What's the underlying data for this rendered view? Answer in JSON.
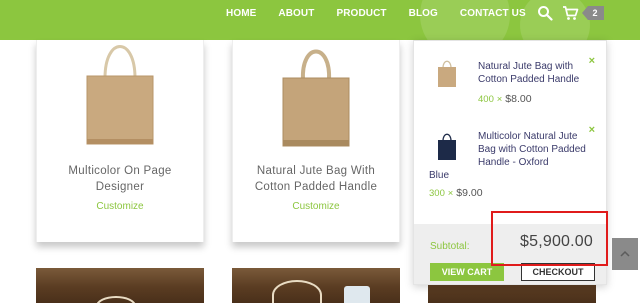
{
  "nav": {
    "items": [
      "HOME",
      "ABOUT",
      "PRODUCT",
      "BLOG",
      "CONTACT US"
    ],
    "search_icon": "search-icon",
    "cart_icon": "cart-icon",
    "cart_count": "2"
  },
  "products": [
    {
      "title": "Multicolor On Page Designer",
      "action": "Customize"
    },
    {
      "title": "Natural Jute Bag With Cotton Padded Handle",
      "action": "Customize"
    }
  ],
  "minicart": {
    "items": [
      {
        "name": "Natural Jute Bag with Cotton Padded Handle",
        "qty": "400",
        "times": "×",
        "price": "$8.00",
        "remove": "×"
      },
      {
        "name": "Multicolor Natural Jute Bag with Cotton Padded Handle - Oxford",
        "name_tail": "Blue",
        "qty": "300",
        "times": "×",
        "price": "$9.00",
        "remove": "×"
      }
    ],
    "subtotal_label": "Subtotal:",
    "subtotal_value": "$5,900.00",
    "view_cart_label": "VIEW CART",
    "checkout_label": "CHECKOUT"
  },
  "colors": {
    "brand_green": "#8cc63f",
    "highlight_red": "#e01b1b",
    "badge_gray": "#8a8a8a"
  }
}
